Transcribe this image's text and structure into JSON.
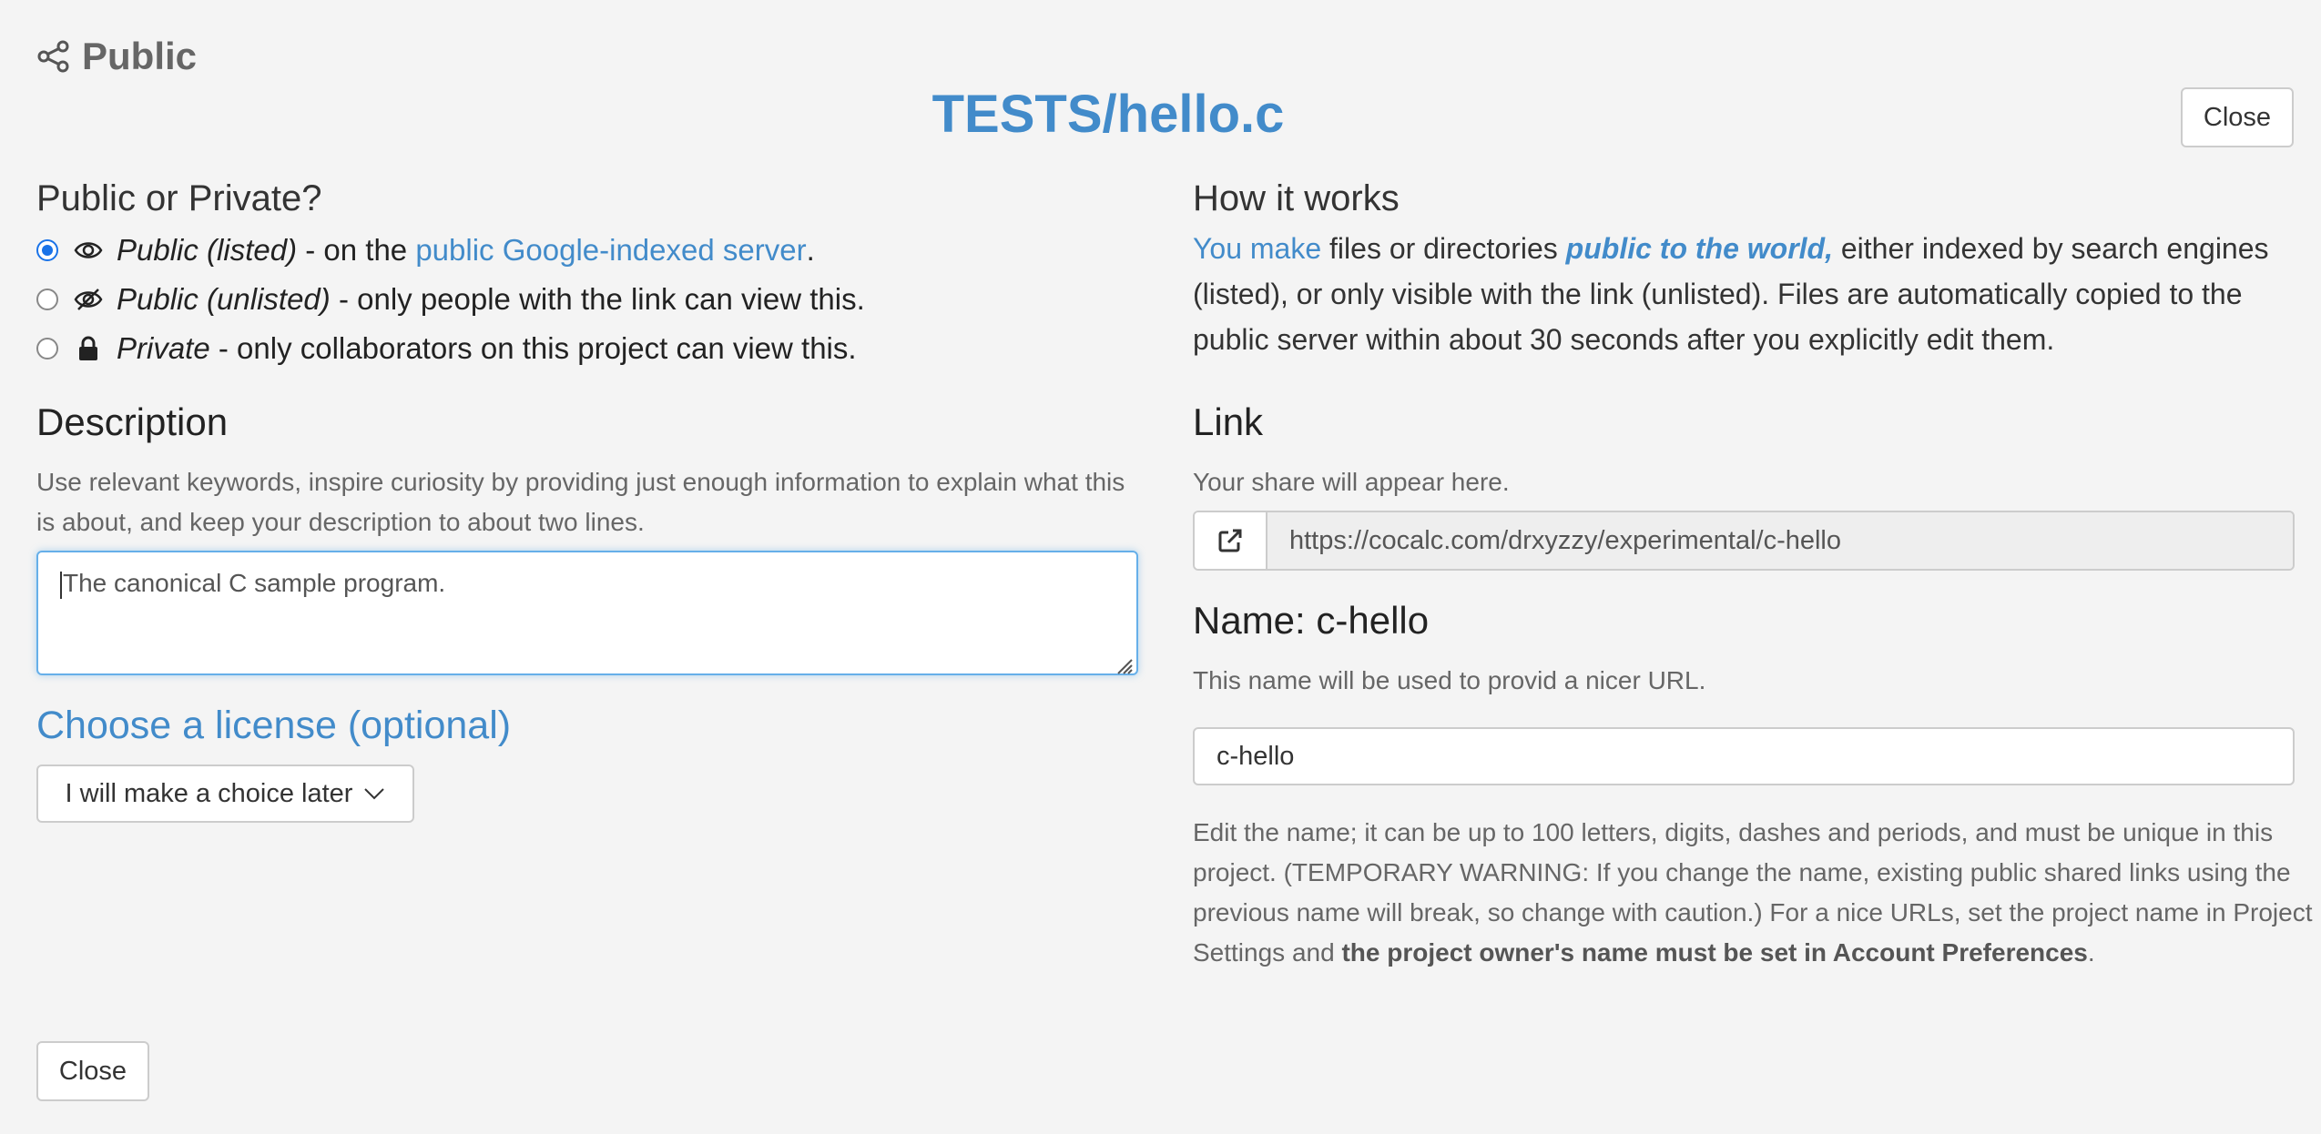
{
  "header": {
    "share_icon": "share-icon",
    "title": "Public",
    "file_title": "TESTS/hello.c",
    "close_label": "Close"
  },
  "visibility": {
    "heading": "Public or Private?",
    "options": [
      {
        "icon": "eye-icon",
        "label": "Public (listed)",
        "desc_prefix": " - on the ",
        "link": "public Google-indexed server",
        "desc_suffix": ".",
        "selected": true
      },
      {
        "icon": "eye-slash-icon",
        "label": "Public (unlisted)",
        "desc": " - only people with the link can view this.",
        "selected": false
      },
      {
        "icon": "lock-icon",
        "label": "Private",
        "desc": " - only collaborators on this project can view this.",
        "selected": false
      }
    ]
  },
  "description": {
    "heading": "Description",
    "help": "Use relevant keywords, inspire curiosity by providing just enough information to explain what this is about, and keep your description to about two lines.",
    "value": "The canonical C sample program."
  },
  "license": {
    "heading": "Choose a license (optional)",
    "selected": "I will make a choice later"
  },
  "how_it_works": {
    "heading": "How it works",
    "link_text": "You make",
    "text_1": " files or directories ",
    "emphasis": "public to the world,",
    "text_2": " either indexed by search engines (listed), or only visible with the link (unlisted). Files are automatically copied to the public server within about 30 seconds after you explicitly edit them."
  },
  "link": {
    "heading": "Link",
    "help": "Your share will appear here.",
    "url": "https://cocalc.com/drxyzzy/experimental/c-hello"
  },
  "name": {
    "heading": "Name: c-hello",
    "help": "This name will be used to provid a nicer URL.",
    "value": "c-hello",
    "note_1": "Edit the name; it can be up to 100 letters, digits, dashes and periods, and must be unique in this project. (TEMPORARY WARNING: If you change the name, existing public shared links using the previous name will break, so change with caution.) For a nice URLs, set the project name in Project Settings and ",
    "note_bold": "the project owner's name must be set in Account Preferences",
    "note_2": "."
  },
  "footer": {
    "close_label": "Close"
  },
  "colors": {
    "accent": "#428bca",
    "radio_selected": "#1a73e8",
    "background": "#f4f4f4"
  }
}
